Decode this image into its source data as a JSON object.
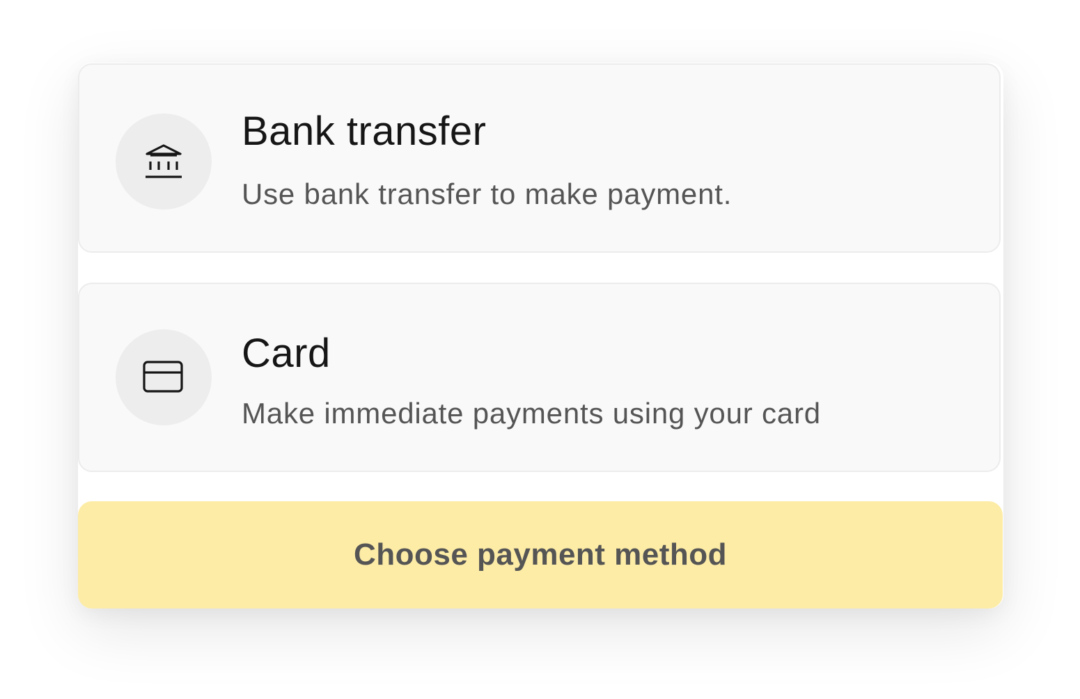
{
  "payment_options": [
    {
      "title": "Bank transfer",
      "description": "Use bank transfer to make payment.",
      "icon": "bank-icon"
    },
    {
      "title": "Card",
      "description": "Make immediate payments using your card",
      "icon": "credit-card-icon"
    }
  ],
  "cta": {
    "label": "Choose payment method",
    "color": "#fdeca6"
  }
}
